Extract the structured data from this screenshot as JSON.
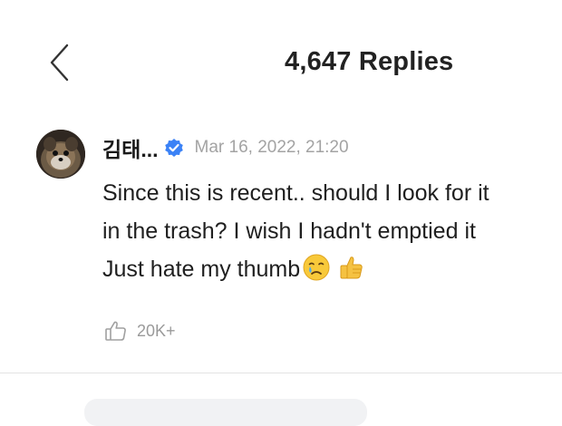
{
  "header": {
    "title": "4,647 Replies",
    "back_icon": "chevron-left-icon"
  },
  "comment": {
    "author": "김태...",
    "verified_icon": "verified-badge-icon",
    "timestamp": "Mar 16, 2022, 21:20",
    "text_lines": [
      "Since this is recent.. should I look for it",
      "in the trash? I wish I hadn't emptied it",
      "Just hate my thumb"
    ],
    "emojis": [
      "crying-face-icon",
      "thumbs-up-icon"
    ],
    "like_icon": "thumbs-up-outline-icon",
    "like_count": "20K+"
  },
  "colors": {
    "verified": "#3b82f6",
    "timestamp": "#a3a3a3",
    "like_count": "#9a9a9a",
    "divider": "#e3e3e3"
  }
}
